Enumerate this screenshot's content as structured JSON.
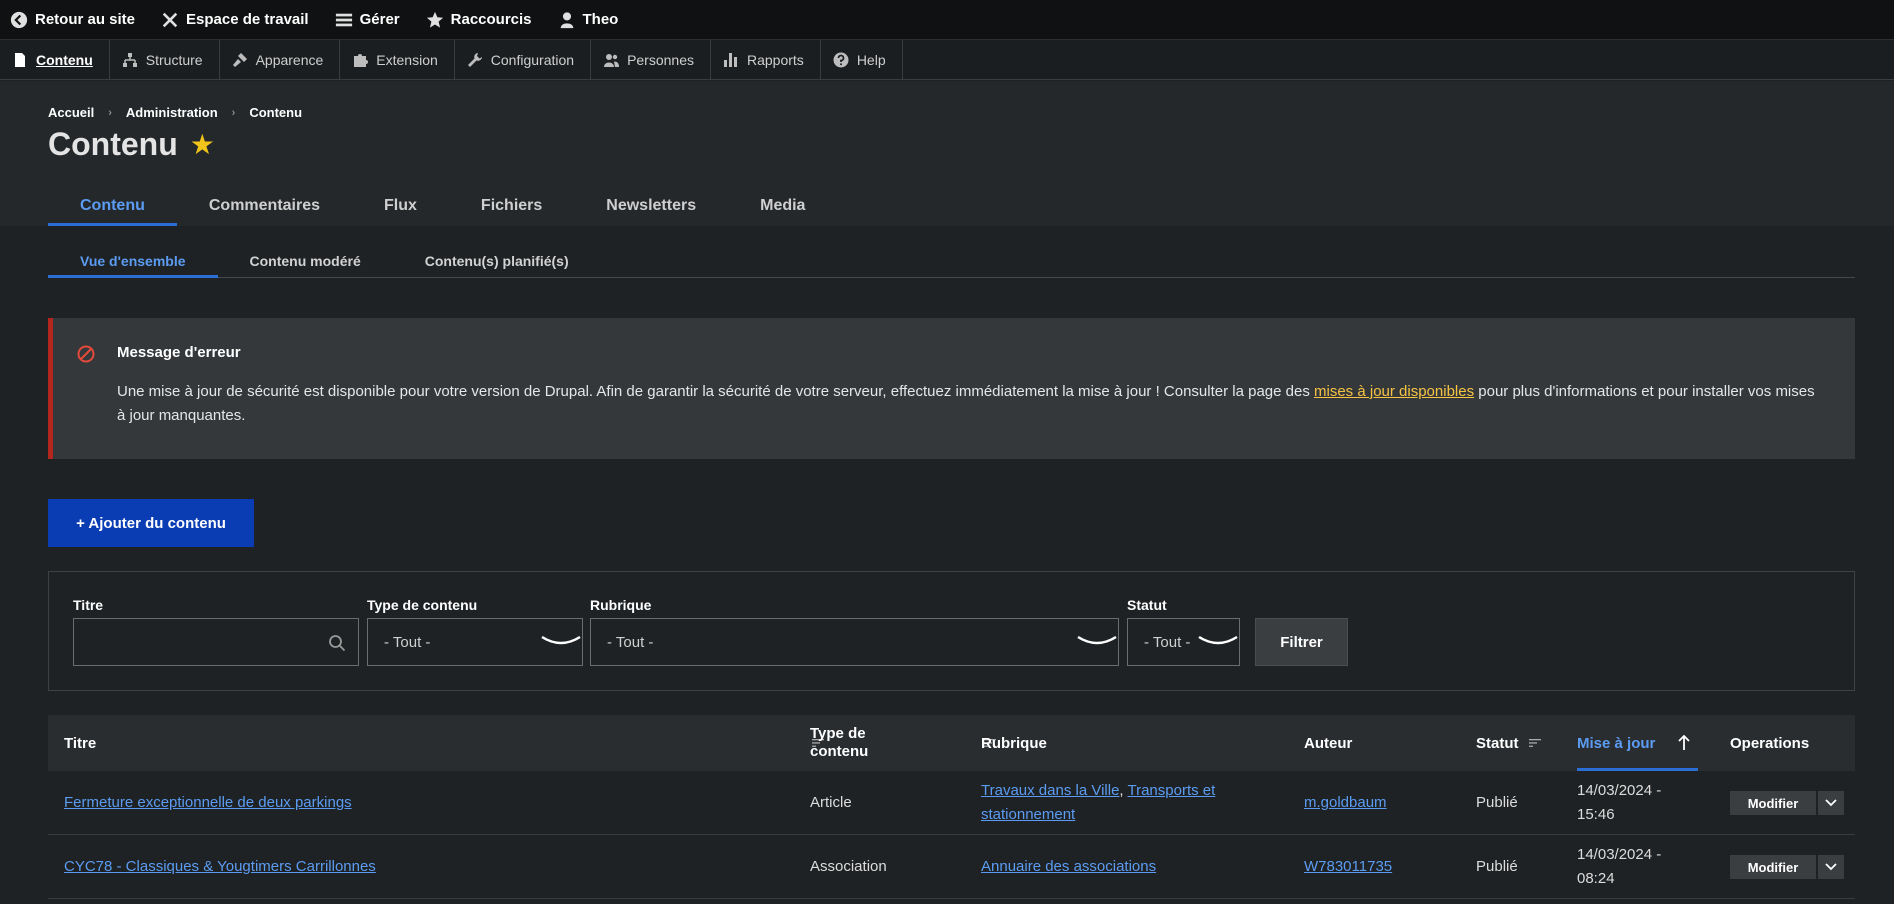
{
  "toolbar": {
    "items": [
      {
        "label": "Retour au site",
        "icon": "back-circle-icon"
      },
      {
        "label": "Espace de travail",
        "icon": "tools-icon"
      },
      {
        "label": "Gérer",
        "icon": "menu-icon"
      },
      {
        "label": "Raccourcis",
        "icon": "star-icon"
      },
      {
        "label": "Theo",
        "icon": "user-icon"
      }
    ]
  },
  "tray": {
    "items": [
      {
        "label": "Contenu",
        "icon": "file-icon",
        "active": true
      },
      {
        "label": "Structure",
        "icon": "structure-icon"
      },
      {
        "label": "Apparence",
        "icon": "brush-icon"
      },
      {
        "label": "Extension",
        "icon": "puzzle-icon"
      },
      {
        "label": "Configuration",
        "icon": "wrench-icon"
      },
      {
        "label": "Personnes",
        "icon": "people-icon"
      },
      {
        "label": "Rapports",
        "icon": "bar-chart-icon"
      },
      {
        "label": "Help",
        "icon": "help-icon"
      }
    ]
  },
  "breadcrumb": [
    "Accueil",
    "Administration",
    "Contenu"
  ],
  "page_title": "Contenu",
  "primary_tabs": [
    "Contenu",
    "Commentaires",
    "Flux",
    "Fichiers",
    "Newsletters",
    "Media"
  ],
  "secondary_tabs": [
    "Vue d'ensemble",
    "Contenu modéré",
    "Contenu(s) planifié(s)"
  ],
  "error": {
    "title": "Message d'erreur",
    "text_before": "Une mise à jour de sécurité est disponible pour votre version de Drupal. Afin de garantir la sécurité de votre serveur, effectuez immédiatement la mise à jour ! Consulter la page des ",
    "link": "mises à jour disponibles",
    "text_after": " pour plus d'informations et pour installer vos mises à jour manquantes."
  },
  "add_button": "+ Ajouter du contenu",
  "filters": {
    "title_label": "Titre",
    "type_label": "Type de contenu",
    "type_value": "- Tout -",
    "rubrique_label": "Rubrique",
    "rubrique_value": "- Tout -",
    "statut_label": "Statut",
    "statut_value": "- Tout -",
    "submit": "Filtrer"
  },
  "table": {
    "headers": {
      "titre": "Titre",
      "type_line1": "Type de",
      "type_line2": "contenu",
      "rubrique": "Rubrique",
      "auteur": "Auteur",
      "statut": "Statut",
      "maj": "Mise à jour",
      "operations": "Operations"
    },
    "rows": [
      {
        "titre": "Fermeture exceptionnelle de deux parkings",
        "type": "Article",
        "rubrique_a": "Travaux dans la Ville",
        "rubrique_sep": ", ",
        "rubrique_b": "Transports et",
        "rubrique_c": "stationnement",
        "auteur": "m.goldbaum",
        "statut": "Publié",
        "date": "14/03/2024 -",
        "time": "15:46",
        "action": "Modifier"
      },
      {
        "titre": "CYC78 - Classiques & Yougtimers Carrillonnes",
        "type": "Association",
        "rubrique_a": "Annuaire des associations",
        "auteur": "W783011735",
        "statut": "Publié",
        "date": "14/03/2024 -",
        "time": "08:24",
        "action": "Modifier"
      }
    ]
  },
  "colors": {
    "accent": "#5b9cf2",
    "primary_button": "#0a3cb3",
    "error_border": "#b3261e",
    "link_warning": "#f6c343",
    "star": "#f0c419"
  }
}
